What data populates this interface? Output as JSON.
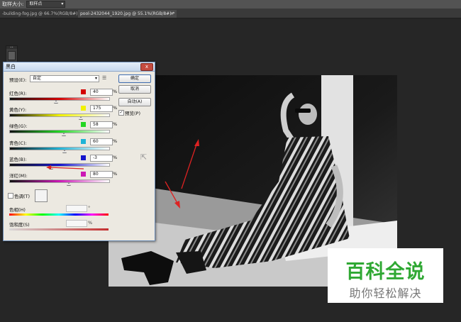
{
  "options_bar": {
    "sample_size_label": "取样大小:",
    "sample_size_value": "取样点"
  },
  "tabs": [
    {
      "label": "-building-fog.jpg @ 66.7%(RGB/8#)",
      "close": "×"
    },
    {
      "label": "pool-2432044_1920.jpg @ 55.1%(RGB/8#) *",
      "close": "×"
    }
  ],
  "dialog": {
    "title": "黑白",
    "close_label": "x",
    "preset_label": "预设(E):",
    "preset_value": "自定",
    "preset_menu_glyph": "☰",
    "sliders": [
      {
        "label": "红色(R):",
        "value": "40",
        "unit": "%",
        "color": "#d40000",
        "thumb": 0.47
      },
      {
        "label": "黄色(Y):",
        "value": "175",
        "unit": "%",
        "color": "#f2f200",
        "thumb": 0.72
      },
      {
        "label": "绿色(G):",
        "value": "58",
        "unit": "%",
        "color": "#23d623",
        "thumb": 0.55
      },
      {
        "label": "青色(C):",
        "value": "60",
        "unit": "%",
        "color": "#1fb3d6",
        "thumb": 0.56
      },
      {
        "label": "蓝色(B):",
        "value": "-3",
        "unit": "%",
        "color": "#1414cc",
        "thumb": 0.42
      },
      {
        "label": "洋红(M):",
        "value": "80",
        "unit": "%",
        "color": "#cc18b5",
        "thumb": 0.6
      }
    ],
    "buttons": {
      "ok": "确定",
      "cancel": "取消",
      "auto": "自动(A)"
    },
    "preview_label": "预览(P)",
    "preview_checked": true,
    "tint_label": "色调(T)",
    "hue_label": "色相(H)",
    "hue_unit": "°",
    "saturation_label": "饱和度(S)",
    "saturation_unit": "%"
  },
  "watermark": {
    "title": "百科全说",
    "subtitle": "助你轻松解决"
  }
}
